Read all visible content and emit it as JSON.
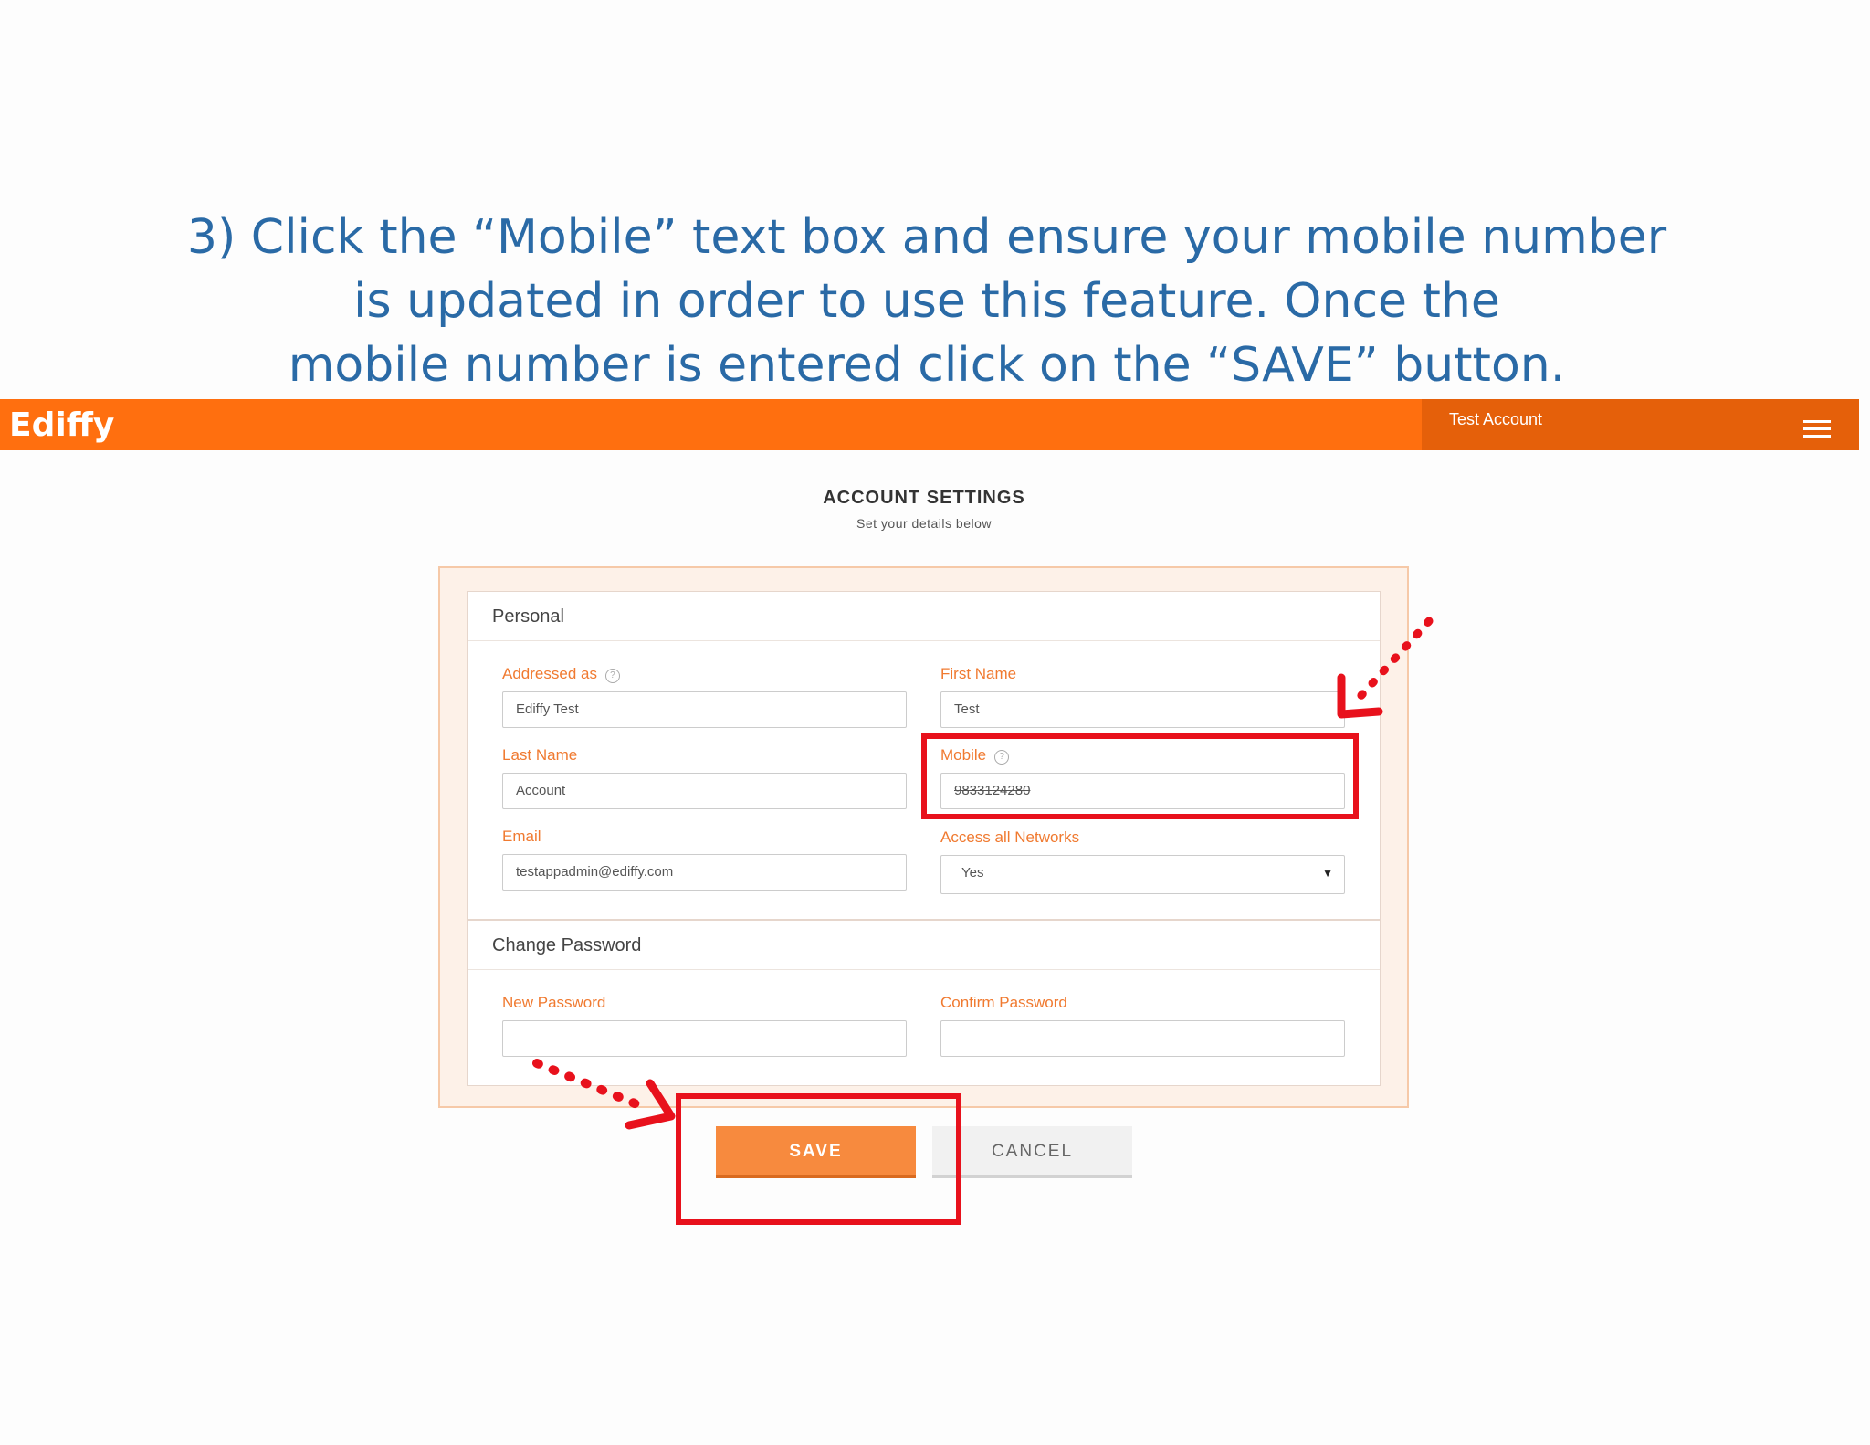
{
  "instruction": {
    "line1": "3) Click the “Mobile” text box and ensure your mobile number",
    "line2": "is updated in order to use this feature. Once the",
    "line3": "mobile number is entered click on the “SAVE” button."
  },
  "topbar": {
    "logo": "Ediffy",
    "account_name": "Test Account",
    "menu_icon": "hamburger-menu-icon",
    "color": "#ff6f0f"
  },
  "page": {
    "title": "ACCOUNT SETTINGS",
    "subtitle": "Set your details below"
  },
  "personal": {
    "heading": "Personal",
    "addressed_as_label": "Addressed as",
    "addressed_as_value": "Ediffy Test",
    "first_name_label": "First Name",
    "first_name_value": "Test",
    "last_name_label": "Last Name",
    "last_name_value": "Account",
    "mobile_label": "Mobile",
    "mobile_value": "9833124280",
    "email_label": "Email",
    "email_value": "testappadmin@ediffy.com",
    "access_label": "Access all Networks",
    "access_value": "Yes"
  },
  "password": {
    "heading": "Change Password",
    "new_label": "New Password",
    "confirm_label": "Confirm Password"
  },
  "buttons": {
    "save": "SAVE",
    "cancel": "CANCEL"
  },
  "annotation_color": "#e8111c"
}
